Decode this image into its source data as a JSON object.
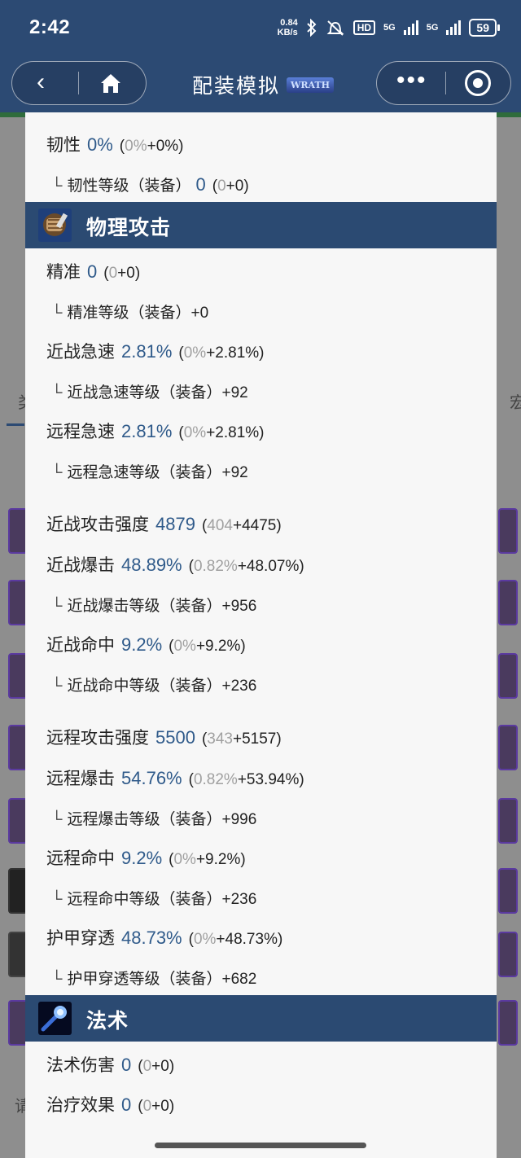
{
  "status": {
    "time": "2:42",
    "net_speed": "0.84",
    "net_unit": "KB/s",
    "hd_badge": "HD",
    "sig1_label": "5G",
    "sig2_label": "5G",
    "battery": "59"
  },
  "nav": {
    "title": "配装模拟",
    "logo_text": "WRATH"
  },
  "side": {
    "left_fragment": "类",
    "right_fragment": "宏",
    "bottom_fragment": "请"
  },
  "stats": {
    "resil": {
      "label": "韧性",
      "value": "0%",
      "base": "0%",
      "bonus": "+0%"
    },
    "resil_rating": {
      "label": "韧性等级（装备）",
      "value": "0",
      "base": "0",
      "bonus": "+0"
    }
  },
  "physical": {
    "title": "物理攻击",
    "expertise": {
      "label": "精准",
      "value": "0",
      "base": "0",
      "bonus": "+0"
    },
    "expertise_rating": {
      "label": "精准等级（装备）+0"
    },
    "melee_haste": {
      "label": "近战急速",
      "value": "2.81%",
      "base": "0%",
      "bonus": "+2.81%"
    },
    "melee_haste_rating": {
      "label": "近战急速等级（装备）+92"
    },
    "ranged_haste": {
      "label": "远程急速",
      "value": "2.81%",
      "base": "0%",
      "bonus": "+2.81%"
    },
    "ranged_haste_rating": {
      "label": "远程急速等级（装备）+92"
    },
    "melee_ap": {
      "label": "近战攻击强度",
      "value": "4879",
      "base": "404",
      "bonus": "+4475"
    },
    "melee_crit": {
      "label": "近战爆击",
      "value": "48.89%",
      "base": "0.82%",
      "bonus": "+48.07%"
    },
    "melee_crit_rating": {
      "label": "近战爆击等级（装备）+956"
    },
    "melee_hit": {
      "label": "近战命中",
      "value": "9.2%",
      "base": "0%",
      "bonus": "+9.2%"
    },
    "melee_hit_rating": {
      "label": "近战命中等级（装备）+236"
    },
    "ranged_ap": {
      "label": "远程攻击强度",
      "value": "5500",
      "base": "343",
      "bonus": "+5157"
    },
    "ranged_crit": {
      "label": "远程爆击",
      "value": "54.76%",
      "base": "0.82%",
      "bonus": "+53.94%"
    },
    "ranged_crit_rating": {
      "label": "远程爆击等级（装备）+996"
    },
    "ranged_hit": {
      "label": "远程命中",
      "value": "9.2%",
      "base": "0%",
      "bonus": "+9.2%"
    },
    "ranged_hit_rating": {
      "label": "远程命中等级（装备）+236"
    },
    "armor_pen": {
      "label": "护甲穿透",
      "value": "48.73%",
      "base": "0%",
      "bonus": "+48.73%"
    },
    "armor_pen_rating": {
      "label": "护甲穿透等级（装备）+682"
    }
  },
  "spell": {
    "title": "法术",
    "spell_damage": {
      "label": "法术伤害",
      "value": "0",
      "base": "0",
      "bonus": "+0"
    },
    "healing": {
      "label": "治疗效果",
      "value": "0",
      "base": "0",
      "bonus": "+0"
    }
  },
  "colors": {
    "header": "#2b4a72",
    "value": "#2f5a8a",
    "muted": "#a0a0a0",
    "panel": "#f7f7f7"
  },
  "icons": [
    "back-icon",
    "home-icon",
    "more-icon",
    "close-mini-program-icon",
    "physical-attack-icon",
    "spell-icon",
    "bluetooth-icon",
    "mute-icon"
  ]
}
